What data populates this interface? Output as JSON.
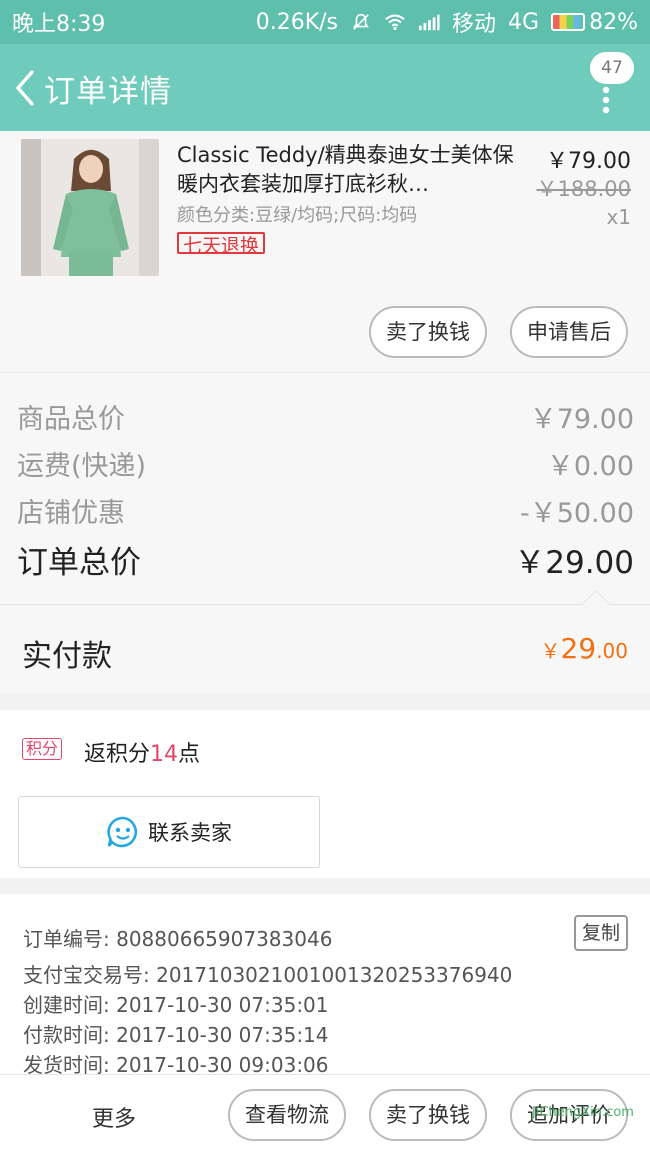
{
  "status_bar": {
    "time": "晚上8:39",
    "speed": "0.26K/s",
    "carrier": "移动",
    "network": "4G",
    "battery": "82%"
  },
  "nav": {
    "title": "订单详情",
    "badge_count": "47"
  },
  "product": {
    "title": "Classic Teddy/精典泰迪女士美体保暖内衣套装加厚打底衫秋…",
    "sku": "颜色分类:豆绿/均码;尺码:均码",
    "tag": "七天退换",
    "price": "￥79.00",
    "original_price": "￥188.00",
    "quantity": "x1",
    "buttons": {
      "sell": "卖了换钱",
      "after_sales": "申请售后"
    }
  },
  "summary": {
    "rows": [
      {
        "label": "商品总价",
        "value": "￥79.00"
      },
      {
        "label": "运费(快递)",
        "value": "￥0.00"
      },
      {
        "label": "店铺优惠",
        "value": "-￥50.00"
      }
    ],
    "total_label": "订单总价",
    "total_value": "￥29.00"
  },
  "paid": {
    "label": "实付款",
    "symbol": "￥",
    "integer": "29",
    "decimal": ".00"
  },
  "points": {
    "tag": "积分",
    "prefix": "返积分",
    "number": "14",
    "suffix": "点"
  },
  "contact": {
    "label": "联系卖家"
  },
  "order_info": {
    "rows": [
      "订单编号: 80880665907383046",
      "支付宝交易号: 2017103021001001320253376940",
      "创建时间: 2017-10-30 07:35:01",
      "付款时间: 2017-10-30 07:35:14",
      "发货时间: 2017-10-30 09:03:06"
    ],
    "copy_label": "复制"
  },
  "footer": {
    "more": "更多",
    "logistics": "查看物流",
    "sell": "卖了换钱",
    "review": "追加评价"
  },
  "watermark": "JiChengXin.com",
  "colors": {
    "status_bar": "#5fbfad",
    "nav_bar": "#6fcbbb",
    "paid_amount": "#f26f12",
    "points_accent": "#e4456a",
    "tag_red": "#e4393c"
  }
}
